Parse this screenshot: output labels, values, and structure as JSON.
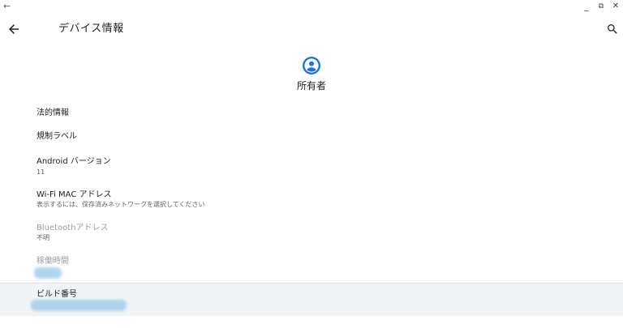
{
  "window": {
    "back_glyph": "←",
    "minimize_glyph": "_",
    "restore_glyph": "⧉",
    "close_glyph": "✕"
  },
  "appbar": {
    "title": "デバイス情報",
    "back_icon": "arrow-left-icon",
    "search_icon": "search-icon"
  },
  "owner": {
    "icon": "account-circle-icon",
    "label": "所有者",
    "accent": "#1a73e8"
  },
  "items": [
    {
      "title": "法的情報",
      "summary": ""
    },
    {
      "title": "規制ラベル",
      "summary": ""
    },
    {
      "title": "Android バージョン",
      "summary": "11"
    },
    {
      "title": "Wi-Fi MAC アドレス",
      "summary": "表示するには、保存済みネットワークを選択してください"
    },
    {
      "title": "Bluetoothアドレス",
      "summary": "不明"
    },
    {
      "title": "稼働時間",
      "summary": ""
    },
    {
      "title": "ビルド番号",
      "summary": ""
    }
  ]
}
